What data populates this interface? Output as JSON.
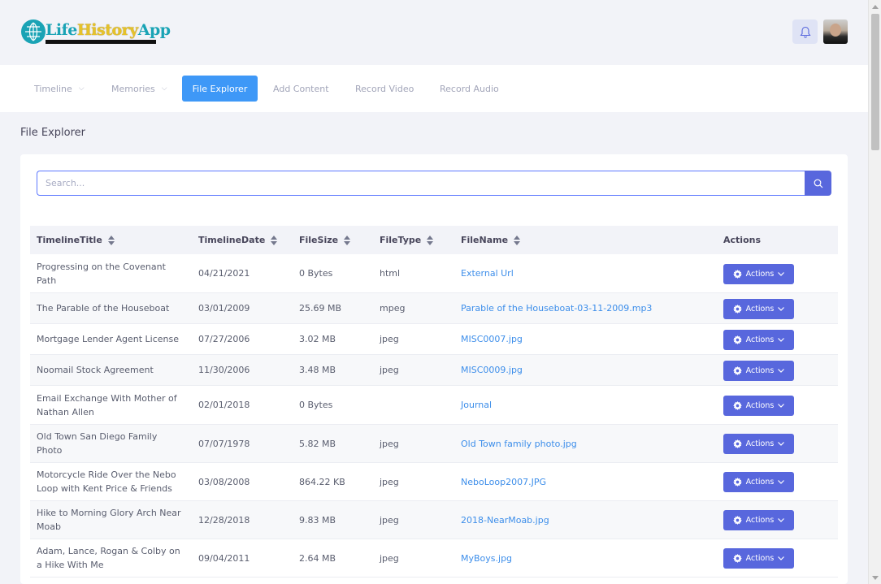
{
  "app": {
    "logo_parts": [
      "Life",
      "History",
      "App"
    ]
  },
  "nav": {
    "items": [
      {
        "label": "Timeline",
        "has_dropdown": true
      },
      {
        "label": "Memories",
        "has_dropdown": true
      },
      {
        "label": "File Explorer",
        "active": true
      },
      {
        "label": "Add Content"
      },
      {
        "label": "Record Video"
      },
      {
        "label": "Record Audio"
      }
    ]
  },
  "page": {
    "title": "File Explorer"
  },
  "search": {
    "placeholder": "Search..."
  },
  "table": {
    "headers": [
      "TimelineTitle",
      "TimelineDate",
      "FileSize",
      "FileType",
      "FileName",
      "Actions"
    ],
    "action_label": "Actions",
    "rows": [
      {
        "title": "Progressing on the Covenant Path",
        "date": "04/21/2021",
        "size": "0 Bytes",
        "type": "html",
        "file": "External Url"
      },
      {
        "title": "The Parable of the Houseboat",
        "date": "03/01/2009",
        "size": "25.69 MB",
        "type": "mpeg",
        "file": "Parable of the Houseboat-03-11-2009.mp3"
      },
      {
        "title": "Mortgage Lender Agent License",
        "date": "07/27/2006",
        "size": "3.02 MB",
        "type": "jpeg",
        "file": "MISC0007.jpg"
      },
      {
        "title": "Noomail Stock Agreement",
        "date": "11/30/2006",
        "size": "3.48 MB",
        "type": "jpeg",
        "file": "MISC0009.jpg"
      },
      {
        "title": "Email Exchange With Mother of Nathan Allen",
        "date": "02/01/2018",
        "size": "0 Bytes",
        "type": "",
        "file": "Journal"
      },
      {
        "title": "Old Town San Diego Family Photo",
        "date": "07/07/1978",
        "size": "5.82 MB",
        "type": "jpeg",
        "file": "Old Town family photo.jpg"
      },
      {
        "title": "Motorcycle Ride Over the Nebo Loop with Kent Price & Friends",
        "date": "03/08/2008",
        "size": "864.22 KB",
        "type": "jpeg",
        "file": "NeboLoop2007.JPG"
      },
      {
        "title": "Hike to Morning Glory Arch Near Moab",
        "date": "12/28/2018",
        "size": "9.83 MB",
        "type": "jpeg",
        "file": "2018-NearMoab.jpg"
      },
      {
        "title": "Adam, Lance, Rogan & Colby on a Hike With Me",
        "date": "09/04/2011",
        "size": "2.64 MB",
        "type": "jpeg",
        "file": "MyBoys.jpg"
      }
    ]
  },
  "colors": {
    "primary": "#5867dd",
    "active_tab": "#3e98f7",
    "link": "#3d8eea",
    "brand_teal": "#1aa3b5",
    "brand_gold": "#e6c229"
  }
}
